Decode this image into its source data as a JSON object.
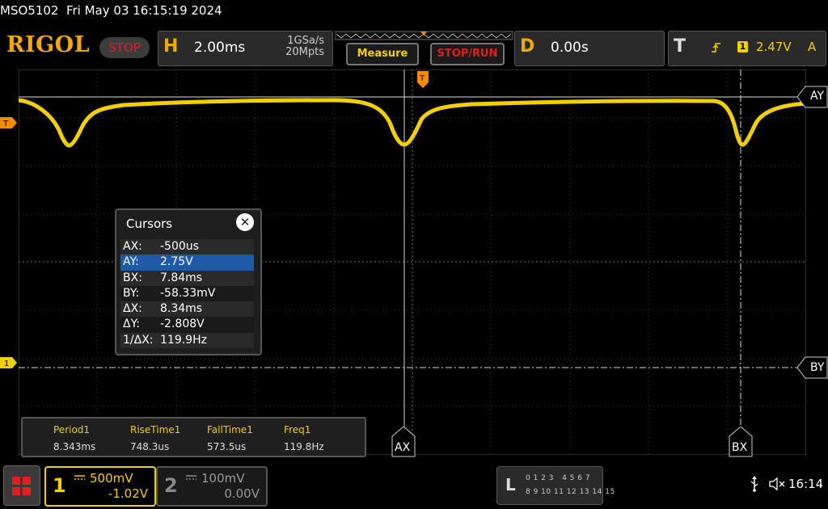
{
  "title_line": "MSO5102  Fri May 03 16:15:19 2024",
  "header": {
    "logo": "RIGOL",
    "stop_label": "STOP",
    "horizontal": {
      "letter": "H",
      "timebase": "2.00ms",
      "sample_rate": "1GSa/s",
      "memory_depth": "20Mpts"
    },
    "measure_label": "Measure",
    "stoprun_label": "STOP/RUN",
    "delay": {
      "letter": "D",
      "value": "0.00s"
    },
    "trigger": {
      "letter": "T",
      "channel": "1",
      "level": "2.47V",
      "mode": "A"
    }
  },
  "cursor_dialog": {
    "title": "Cursors",
    "close_glyph": "✕",
    "rows": [
      {
        "label": "AX:",
        "value": "-500us",
        "selected": false
      },
      {
        "label": "AY:",
        "value": "2.75V",
        "selected": true
      },
      {
        "label": "BX:",
        "value": "7.84ms",
        "selected": false
      },
      {
        "label": "BY:",
        "value": "-58.33mV",
        "selected": false
      },
      {
        "label": "ΔX:",
        "value": "8.34ms",
        "selected": false
      },
      {
        "label": "ΔY:",
        "value": "-2.808V",
        "selected": false
      },
      {
        "label": "1/ΔX:",
        "value": "119.9Hz",
        "selected": false
      }
    ]
  },
  "measurements": [
    {
      "name": "Period1",
      "value": "8.343ms"
    },
    {
      "name": "RiseTime1",
      "value": "748.3us"
    },
    {
      "name": "FallTime1",
      "value": "573.5us"
    },
    {
      "name": "Freq1",
      "value": "119.8Hz"
    }
  ],
  "cursor_labels": {
    "ax": "AX",
    "bx": "BX",
    "ay": "AY",
    "by": "BY"
  },
  "left_markers": {
    "trigger": "T",
    "ch1": "1"
  },
  "channels": {
    "ch1": {
      "number": "1",
      "scale": "500mV",
      "offset": "-1.02V",
      "color": "#f2d000"
    },
    "ch2": {
      "number": "2",
      "scale": "100mV",
      "offset": "0.00V",
      "color": "#888888"
    }
  },
  "logic": {
    "letter": "L",
    "row1": "0 1 2 3   4 5 6 7",
    "row2": "8 9 10 11 12 13 14 15"
  },
  "status": {
    "clock": "16:14",
    "usb_icon": "usb-icon",
    "speaker_icon": "speaker-muted-icon"
  },
  "colors": {
    "trace": "#f2d000",
    "brand": "#f2a900",
    "stop": "#e02020",
    "selection": "#1e5aa8"
  }
}
